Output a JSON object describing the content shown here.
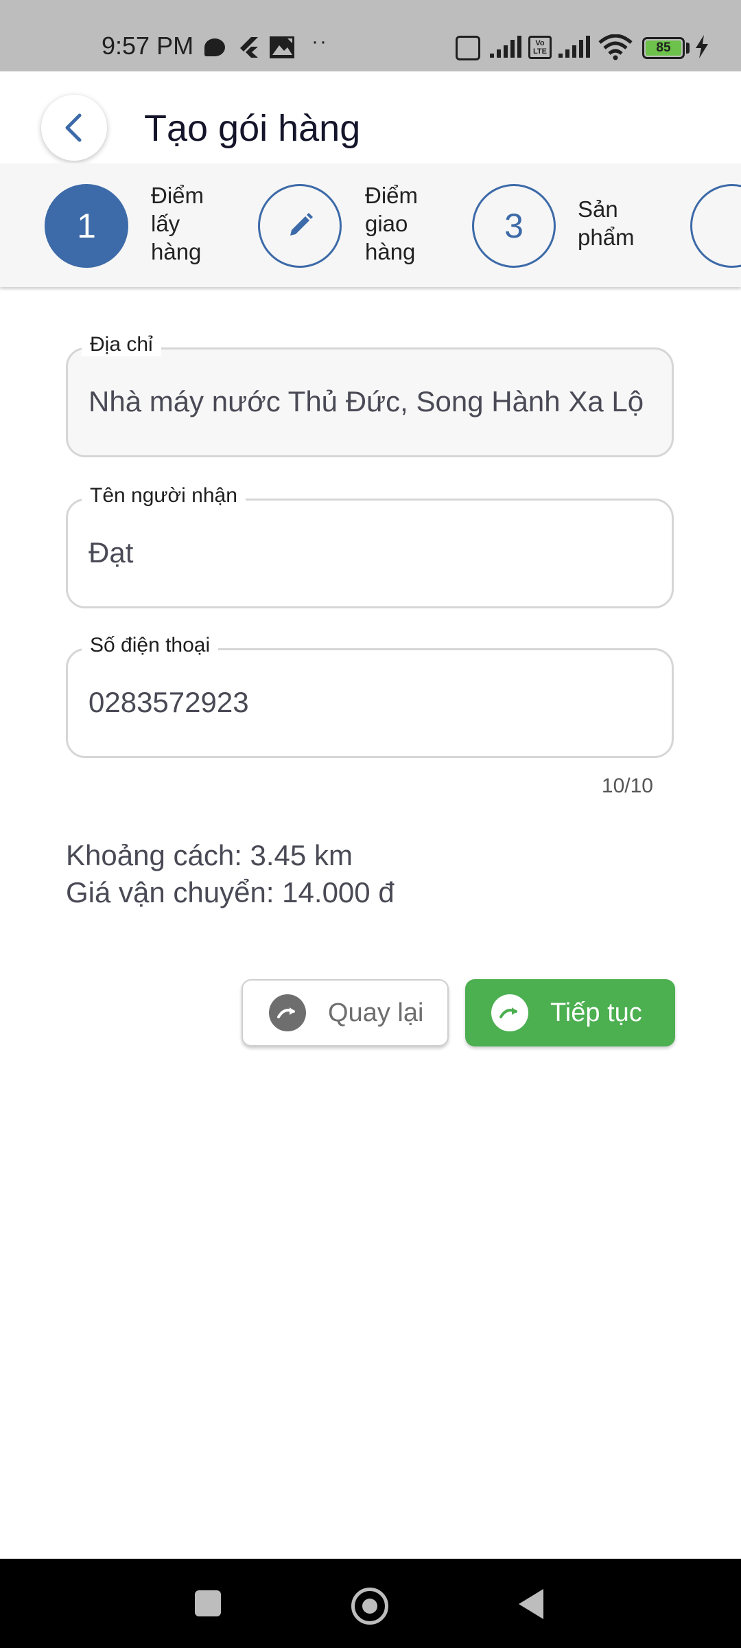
{
  "status_bar": {
    "time": "9:57 PM",
    "dots": "··",
    "volte": "Vo LTE",
    "battery": "85",
    "icons": [
      "chat-bubble-icon",
      "flutter-icon",
      "photo-icon",
      "nfc-icon",
      "signal-icon",
      "volte-icon",
      "wifi-icon",
      "battery-icon",
      "charging-icon"
    ]
  },
  "header": {
    "title": "Tạo gói hàng",
    "back_icon": "chevron-left-icon"
  },
  "stepper": {
    "steps": [
      {
        "marker": "1",
        "label_lines": [
          "Điểm",
          "lấy",
          "hàng"
        ],
        "state": "active"
      },
      {
        "marker": "",
        "label_lines": [
          "Điểm",
          "giao",
          "hàng"
        ],
        "state": "editing",
        "icon": "pencil-icon"
      },
      {
        "marker": "3",
        "label_lines": [
          "Sản",
          "phẩm"
        ],
        "state": "pending"
      }
    ],
    "colors": {
      "accent": "#3d6aa8"
    }
  },
  "form": {
    "address": {
      "label": "Địa chỉ",
      "value": "Nhà máy nước Thủ Đức, Song Hành Xa Lộ Hà Nội"
    },
    "recipient": {
      "label": "Tên người nhận",
      "value": "Đạt"
    },
    "phone": {
      "label": "Số điện thoại",
      "value": "0283572923",
      "counter": "10/10"
    }
  },
  "info": {
    "distance": "Khoảng cách: 3.45 km",
    "shipping_fee": "Giá vận chuyển: 14.000 đ"
  },
  "buttons": {
    "back_label": "Quay lại",
    "next_label": "Tiếp tục",
    "colors": {
      "next": "#4caf50",
      "back_icon": "#6e6e6e"
    }
  },
  "nav_bar": {
    "icons": [
      "recents-square-icon",
      "home-circle-icon",
      "back-triangle-icon"
    ]
  }
}
